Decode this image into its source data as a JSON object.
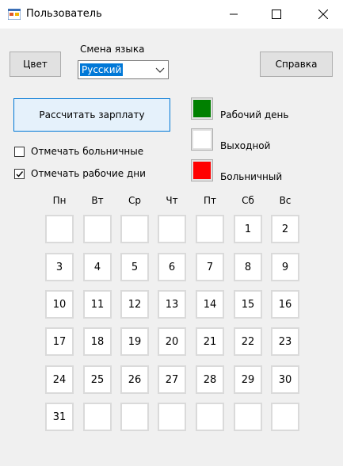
{
  "window": {
    "title": "Пользователь"
  },
  "toolbar": {
    "color_button": "Цвет",
    "help_button": "Справка"
  },
  "language": {
    "label": "Смена языка",
    "selected": "Русский"
  },
  "actions": {
    "calc_button": "Рассчитать зарплату"
  },
  "options": {
    "mark_sick": {
      "label": "Отмечать больничные",
      "checked": false
    },
    "mark_work": {
      "label": "Отмечать рабочие дни",
      "checked": true
    }
  },
  "legend": [
    {
      "label": "Рабочий день",
      "color": "#008000"
    },
    {
      "label": "Выходной",
      "color": "#ffffff"
    },
    {
      "label": "Больничный",
      "color": "#ff0000"
    }
  ],
  "calendar": {
    "weekdays": [
      "Пн",
      "Вт",
      "Ср",
      "Чт",
      "Пт",
      "Сб",
      "Вс"
    ],
    "rows": [
      [
        "",
        "",
        "",
        "",
        "",
        "1",
        "2"
      ],
      [
        "3",
        "4",
        "5",
        "6",
        "7",
        "8",
        "9"
      ],
      [
        "10",
        "11",
        "12",
        "13",
        "14",
        "15",
        "16"
      ],
      [
        "17",
        "18",
        "19",
        "20",
        "21",
        "22",
        "23"
      ],
      [
        "24",
        "25",
        "26",
        "27",
        "28",
        "29",
        "30"
      ],
      [
        "31",
        "",
        "",
        "",
        "",
        "",
        ""
      ]
    ]
  }
}
